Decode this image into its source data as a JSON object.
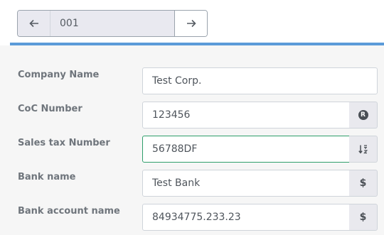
{
  "pager": {
    "value": "001",
    "prev_icon": "arrow-left-icon",
    "next_icon": "arrow-right-icon"
  },
  "form": {
    "fields": [
      {
        "label": "Company Name",
        "value": "Test Corp.",
        "addon_icon": null
      },
      {
        "label": "CoC Number",
        "value": "123456",
        "addon_icon": "registered-icon",
        "addon_text": "R"
      },
      {
        "label": "Sales tax Number",
        "value": "56788DF",
        "addon_icon": "sort-numeric-down-icon",
        "state": "valid"
      },
      {
        "label": "Bank name",
        "value": "Test Bank",
        "addon_icon": "dollar-icon",
        "addon_text": "$"
      },
      {
        "label": "Bank account name",
        "value": "84934775.233.23",
        "addon_icon": "dollar-icon",
        "addon_text": "$"
      }
    ]
  },
  "colors": {
    "accent_divider": "#5b9bd9",
    "valid_border": "#2e9e6b",
    "addon_bg": "#e9e9ee",
    "panel_bg": "#f6f6f6"
  }
}
